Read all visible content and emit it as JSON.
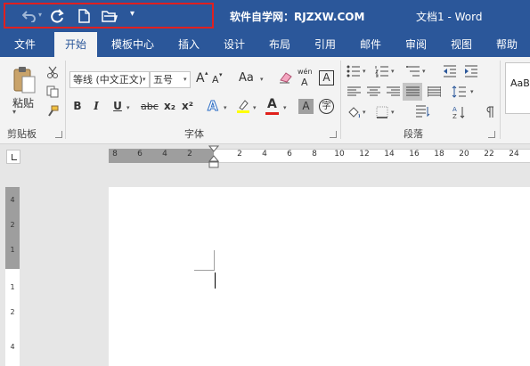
{
  "titlebar": {
    "site": "软件自学网：RJZXW.COM",
    "document": "文档1  -  Word",
    "qat": {
      "undo_icon": "undo-icon",
      "redo_icon": "redo-icon",
      "new_icon": "new-document-icon",
      "open_icon": "open-folder-icon",
      "customize_icon": "customize-qat-icon"
    }
  },
  "tabs": [
    "文件",
    "开始",
    "模板中心",
    "插入",
    "设计",
    "布局",
    "引用",
    "邮件",
    "审阅",
    "视图",
    "帮助"
  ],
  "active_tab": "开始",
  "clipboard": {
    "paste_label": "粘贴",
    "group_label": "剪贴板"
  },
  "font": {
    "font_name": "等线 (中文正文)",
    "font_size": "五号",
    "group_label": "字体",
    "bold": "B",
    "italic": "I",
    "underline": "U",
    "strike": "abc",
    "subscript": "x₂",
    "superscript": "x²",
    "grow": "A",
    "shrink": "A",
    "change_case": "Aa",
    "phonetic": "wén",
    "char_border": "A",
    "text_effect": "A",
    "font_color": "A",
    "char_shading": "A",
    "enclose": "字"
  },
  "paragraph": {
    "group_label": "段落"
  },
  "styles": {
    "preview": "AaB"
  },
  "colors": {
    "brand": "#2b579a",
    "highlight": "#ffff00",
    "font_color": "#e0201b",
    "qat_box": "#e02020"
  },
  "hruler": {
    "left_ticks": [
      "8",
      "6",
      "4",
      "2"
    ],
    "right_ticks": [
      "2",
      "4",
      "6",
      "8",
      "10",
      "12",
      "14",
      "16",
      "18",
      "20",
      "22",
      "24"
    ]
  },
  "vruler": {
    "ticks": [
      "4",
      "2",
      "1",
      "1",
      "2",
      "4"
    ]
  }
}
